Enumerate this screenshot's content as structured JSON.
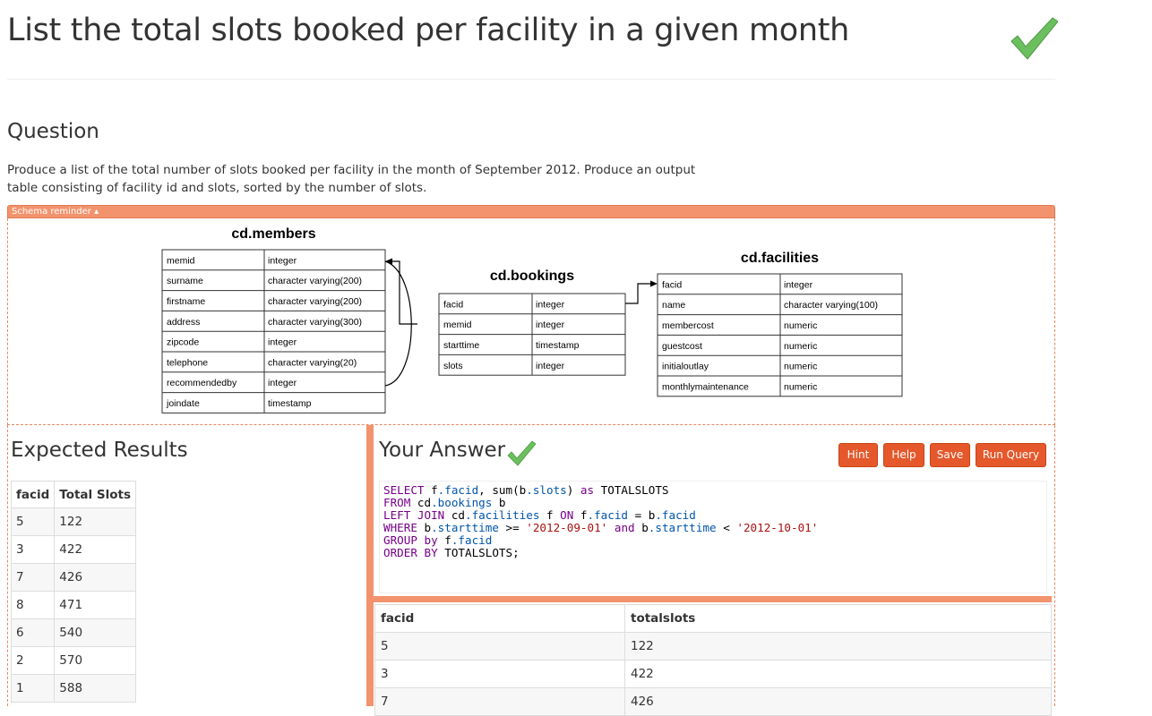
{
  "title": "List the total slots booked per facility in a given month",
  "question": {
    "heading": "Question",
    "text": "Produce a list of the total number of slots booked per facility in the month of September 2012. Produce an output table consisting of facility id and slots, sorted by the number of slots."
  },
  "schema": {
    "toggle_label": "Schema reminder ▴",
    "members": {
      "title": "cd.members",
      "rows": [
        {
          "col": "memid",
          "type": "integer"
        },
        {
          "col": "surname",
          "type": "character varying(200)"
        },
        {
          "col": "firstname",
          "type": "character varying(200)"
        },
        {
          "col": "address",
          "type": "character varying(300)"
        },
        {
          "col": "zipcode",
          "type": "integer"
        },
        {
          "col": "telephone",
          "type": "character varying(20)"
        },
        {
          "col": "recommendedby",
          "type": "integer"
        },
        {
          "col": "joindate",
          "type": "timestamp"
        }
      ]
    },
    "bookings": {
      "title": "cd.bookings",
      "rows": [
        {
          "col": "facid",
          "type": "integer"
        },
        {
          "col": "memid",
          "type": "integer"
        },
        {
          "col": "starttime",
          "type": "timestamp"
        },
        {
          "col": "slots",
          "type": "integer"
        }
      ]
    },
    "facilities": {
      "title": "cd.facilities",
      "rows": [
        {
          "col": "facid",
          "type": "integer"
        },
        {
          "col": "name",
          "type": "character varying(100)"
        },
        {
          "col": "membercost",
          "type": "numeric"
        },
        {
          "col": "guestcost",
          "type": "numeric"
        },
        {
          "col": "initialoutlay",
          "type": "numeric"
        },
        {
          "col": "monthlymaintenance",
          "type": "numeric"
        }
      ]
    }
  },
  "expected": {
    "heading": "Expected Results",
    "columns": [
      "facid",
      "Total Slots"
    ],
    "rows": [
      [
        "5",
        "122"
      ],
      [
        "3",
        "422"
      ],
      [
        "7",
        "426"
      ],
      [
        "8",
        "471"
      ],
      [
        "6",
        "540"
      ],
      [
        "2",
        "570"
      ],
      [
        "1",
        "588"
      ]
    ]
  },
  "answer": {
    "heading": "Your Answer",
    "buttons": {
      "hint": "Hint",
      "help": "Help",
      "save": "Save",
      "run": "Run Query"
    },
    "code_lines": [
      [
        {
          "t": "SELECT ",
          "c": "kw"
        },
        {
          "t": "f"
        },
        {
          "t": ".facid",
          "c": "prop"
        },
        {
          "t": ", sum(b"
        },
        {
          "t": ".slots",
          "c": "prop"
        },
        {
          "t": ") "
        },
        {
          "t": "as",
          "c": "kw"
        },
        {
          "t": " TOTALSLOTS"
        }
      ],
      [
        {
          "t": "FROM ",
          "c": "kw"
        },
        {
          "t": "cd"
        },
        {
          "t": ".bookings",
          "c": "prop"
        },
        {
          "t": " b"
        }
      ],
      [
        {
          "t": "LEFT JOIN ",
          "c": "kw"
        },
        {
          "t": "cd"
        },
        {
          "t": ".facilities",
          "c": "prop"
        },
        {
          "t": " f "
        },
        {
          "t": "ON",
          "c": "kw"
        },
        {
          "t": " f"
        },
        {
          "t": ".facid",
          "c": "prop"
        },
        {
          "t": " = b"
        },
        {
          "t": ".facid",
          "c": "prop"
        }
      ],
      [
        {
          "t": "WHERE ",
          "c": "kw"
        },
        {
          "t": "b"
        },
        {
          "t": ".starttime",
          "c": "prop"
        },
        {
          "t": " >= "
        },
        {
          "t": "'2012-09-01'",
          "c": "str"
        },
        {
          "t": " "
        },
        {
          "t": "and",
          "c": "kw"
        },
        {
          "t": " b"
        },
        {
          "t": ".starttime",
          "c": "prop"
        },
        {
          "t": " < "
        },
        {
          "t": "'2012-10-01'",
          "c": "str"
        }
      ],
      [
        {
          "t": "GROUP ",
          "c": "kw"
        },
        {
          "t": "by",
          "c": "kw"
        },
        {
          "t": " f"
        },
        {
          "t": ".facid",
          "c": "prop"
        }
      ],
      [
        {
          "t": "ORDER BY ",
          "c": "kw"
        },
        {
          "t": "TOTALSLOTS;"
        }
      ]
    ],
    "result_columns": [
      "facid",
      "totalslots"
    ],
    "result_rows": [
      [
        "5",
        "122"
      ],
      [
        "3",
        "422"
      ],
      [
        "7",
        "426"
      ]
    ]
  },
  "colors": {
    "accent": "#f3936d",
    "button": "#e5582b",
    "check": "#5cb85c"
  }
}
